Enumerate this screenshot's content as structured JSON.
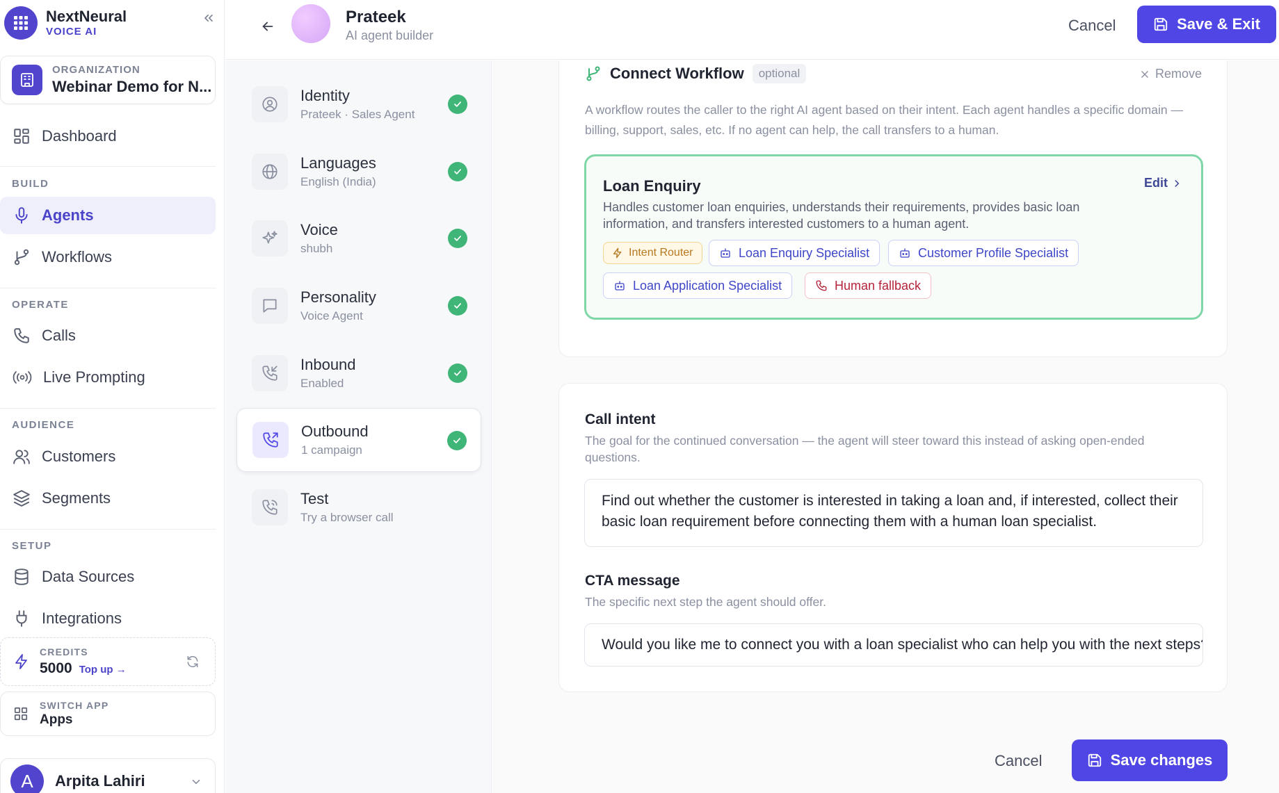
{
  "brand": {
    "name": "NextNeural",
    "sub": "VOICE AI"
  },
  "organization": {
    "label": "ORGANIZATION",
    "name": "Webinar Demo for N..."
  },
  "nav": {
    "dashboard": "Dashboard",
    "build_title": "BUILD",
    "agents": "Agents",
    "workflows": "Workflows",
    "operate_title": "OPERATE",
    "calls": "Calls",
    "live_prompting": "Live Prompting",
    "audience_title": "AUDIENCE",
    "customers": "Customers",
    "segments": "Segments",
    "setup_title": "SETUP",
    "data_sources": "Data Sources",
    "integrations": "Integrations"
  },
  "credits": {
    "label": "CREDITS",
    "value": "5000",
    "topup": "Top up →"
  },
  "switch_app": {
    "label": "SWITCH APP",
    "name": "Apps"
  },
  "user": {
    "initial": "A",
    "name": "Arpita Lahiri"
  },
  "header": {
    "agent_name": "Prateek",
    "agent_sub": "AI agent builder",
    "cancel": "Cancel",
    "save_exit": "Save & Exit"
  },
  "steps": [
    {
      "title": "Identity",
      "sub": "Prateek · Sales Agent"
    },
    {
      "title": "Languages",
      "sub": "English (India)"
    },
    {
      "title": "Voice",
      "sub": "shubh"
    },
    {
      "title": "Personality",
      "sub": "Voice Agent"
    },
    {
      "title": "Inbound",
      "sub": "Enabled"
    },
    {
      "title": "Outbound",
      "sub": "1 campaign"
    },
    {
      "title": "Test",
      "sub": "Try a browser call"
    }
  ],
  "workflow": {
    "title": "Connect Workflow",
    "badge": "optional",
    "remove": "Remove",
    "description": "A workflow routes the caller to the right AI agent based on their intent. Each agent handles a specific domain — billing, support, sales, etc. If no agent can help, the call transfers to a human.",
    "selected": {
      "name": "Loan Enquiry",
      "description": "Handles customer loan enquiries, understands their requirements, provides basic loan information, and transfers interested customers to a human agent.",
      "edit": "Edit",
      "chips": {
        "router": "Intent Router",
        "loan_enquiry": "Loan Enquiry Specialist",
        "customer_profile": "Customer Profile Specialist",
        "loan_application": "Loan Application Specialist",
        "fallback": "Human fallback"
      }
    }
  },
  "call_intent": {
    "label": "Call intent",
    "help": "The goal for the continued conversation — the agent will steer toward this instead of asking open-ended questions.",
    "value": "Find out whether the customer is interested in taking a loan and, if interested, collect their basic loan requirement before connecting them with a human loan specialist."
  },
  "cta": {
    "label": "CTA message",
    "help": "The specific next step the agent should offer.",
    "value": "Would you like me to connect you with a loan specialist who can help you with the next steps?"
  },
  "footer": {
    "cancel": "Cancel",
    "save": "Save changes"
  },
  "colors": {
    "accent": "#4f46e5",
    "success": "#3fb677",
    "workflow_border": "#7fd6a6",
    "fallback": "#b4233a",
    "router": "#b7791f"
  }
}
